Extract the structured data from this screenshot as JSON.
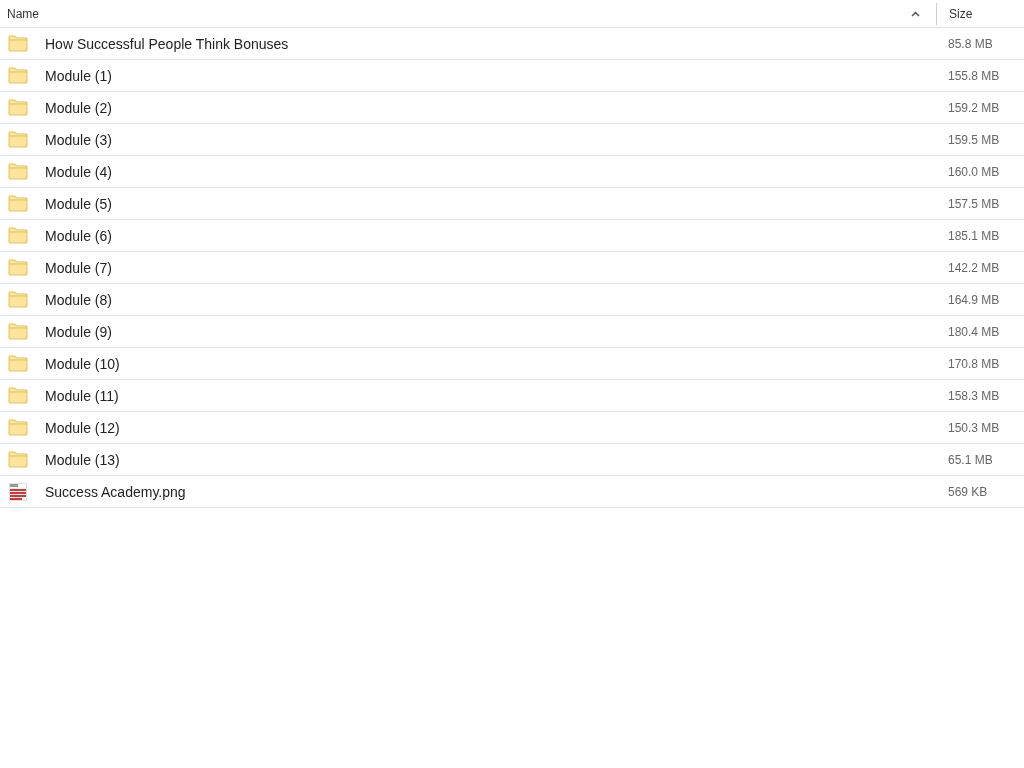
{
  "table": {
    "columns": [
      {
        "label": "Name",
        "sorted": true
      },
      {
        "label": "Size",
        "sorted": false
      }
    ],
    "rows": [
      {
        "kind": "folder",
        "name": "How Successful People Think Bonuses",
        "size": "85.8 MB"
      },
      {
        "kind": "folder",
        "name": "Module (1)",
        "size": "155.8 MB"
      },
      {
        "kind": "folder",
        "name": "Module (2)",
        "size": "159.2 MB"
      },
      {
        "kind": "folder",
        "name": "Module (3)",
        "size": "159.5 MB"
      },
      {
        "kind": "folder",
        "name": "Module (4)",
        "size": "160.0 MB"
      },
      {
        "kind": "folder",
        "name": "Module (5)",
        "size": "157.5 MB"
      },
      {
        "kind": "folder",
        "name": "Module (6)",
        "size": "185.1 MB"
      },
      {
        "kind": "folder",
        "name": "Module (7)",
        "size": "142.2 MB"
      },
      {
        "kind": "folder",
        "name": "Module (8)",
        "size": "164.9 MB"
      },
      {
        "kind": "folder",
        "name": "Module (9)",
        "size": "180.4 MB"
      },
      {
        "kind": "folder",
        "name": "Module (10)",
        "size": "170.8 MB"
      },
      {
        "kind": "folder",
        "name": "Module (11)",
        "size": "158.3 MB"
      },
      {
        "kind": "folder",
        "name": "Module (12)",
        "size": "150.3 MB"
      },
      {
        "kind": "folder",
        "name": "Module (13)",
        "size": "65.1 MB"
      },
      {
        "kind": "image",
        "name": "Success Academy.png",
        "size": "569 KB"
      }
    ]
  }
}
